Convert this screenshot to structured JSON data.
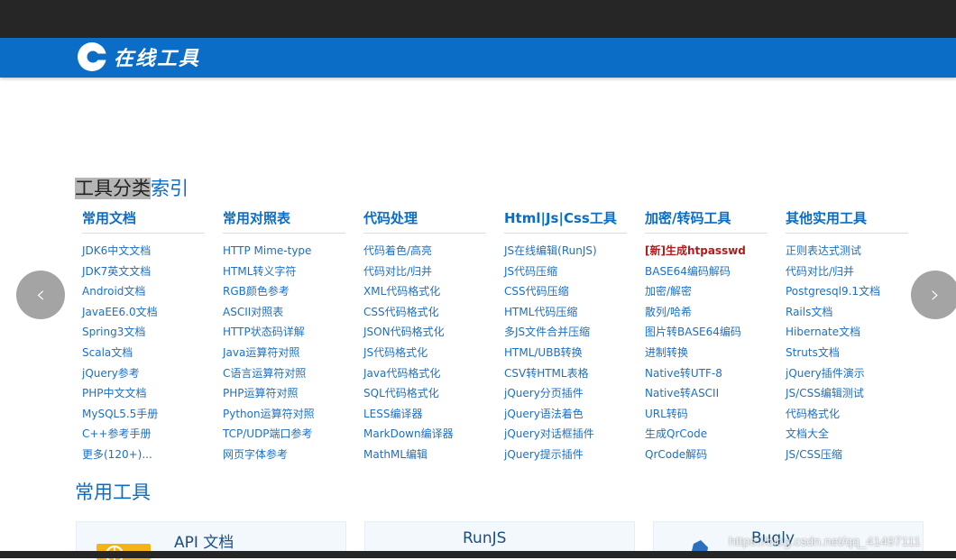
{
  "header": {
    "logo_text": "在线工具",
    "brand_color": "#0b6dc5"
  },
  "index_section": {
    "title_highlight": "工具分类",
    "title_rest": "索引",
    "columns": [
      {
        "heading": "常用文档",
        "items": [
          "JDK6中文文档",
          "JDK7英文文档",
          "Android文档",
          "JavaEE6.0文档",
          "Spring3文档",
          "Scala文档",
          "jQuery参考",
          "PHP中文文档",
          "MySQL5.5手册",
          "C++参考手册",
          "更多(120+)..."
        ]
      },
      {
        "heading": "常用对照表",
        "items": [
          "HTTP Mime-type",
          "HTML转义字符",
          "RGB颜色参考",
          "ASCII对照表",
          "HTTP状态码详解",
          "Java运算符对照",
          "C语言运算符对照",
          "PHP运算符对照",
          "Python运算符对照",
          "TCP/UDP端口参考",
          "网页字体参考"
        ]
      },
      {
        "heading": "代码处理",
        "items": [
          "代码着色/高亮",
          "代码对比/归并",
          "XML代码格式化",
          "CSS代码格式化",
          "JSON代码格式化",
          "JS代码格式化",
          "Java代码格式化",
          "SQL代码格式化",
          "LESS编译器",
          "MarkDown编译器",
          "MathML编辑"
        ]
      },
      {
        "heading": "Html|Js|Css工具",
        "items": [
          "JS在线编辑(RunJS)",
          "JS代码压缩",
          "CSS代码压缩",
          "HTML代码压缩",
          "多JS文件合并压缩",
          "HTML/UBB转换",
          "CSV转HTML表格",
          "jQuery分页插件",
          "jQuery语法着色",
          "jQuery对话框插件",
          "jQuery提示插件"
        ]
      },
      {
        "heading": "加密/转码工具",
        "items": [
          "[新]生成htpasswd",
          "BASE64编码解码",
          "加密/解密",
          "散列/哈希",
          "图片转BASE64编码",
          "进制转换",
          "Native转UTF-8",
          "Native转ASCII",
          "URL转码",
          "生成QrCode",
          "QrCode解码"
        ]
      },
      {
        "heading": "其他实用工具",
        "items": [
          "正则表达式测试",
          "代码对比/归并",
          "Postgresql9.1文档",
          "Rails文档",
          "Hibernate文档",
          "Struts文档",
          "jQuery插件演示",
          "JS/CSS编辑测试",
          "代码格式化",
          "文档大全",
          "JS/CSS压缩"
        ]
      }
    ]
  },
  "common_section": {
    "title": "常用工具",
    "cards": [
      {
        "title": "API 文档",
        "icon": "api-docs-icon"
      },
      {
        "title": "RunJS",
        "icon": ""
      },
      {
        "title": "Bugly",
        "icon": "bugly-icon"
      }
    ]
  },
  "carousel": {
    "prev_glyph": "‹",
    "next_glyph": "›"
  },
  "watermark": "https://blog.csdn.net/qq_41497111"
}
